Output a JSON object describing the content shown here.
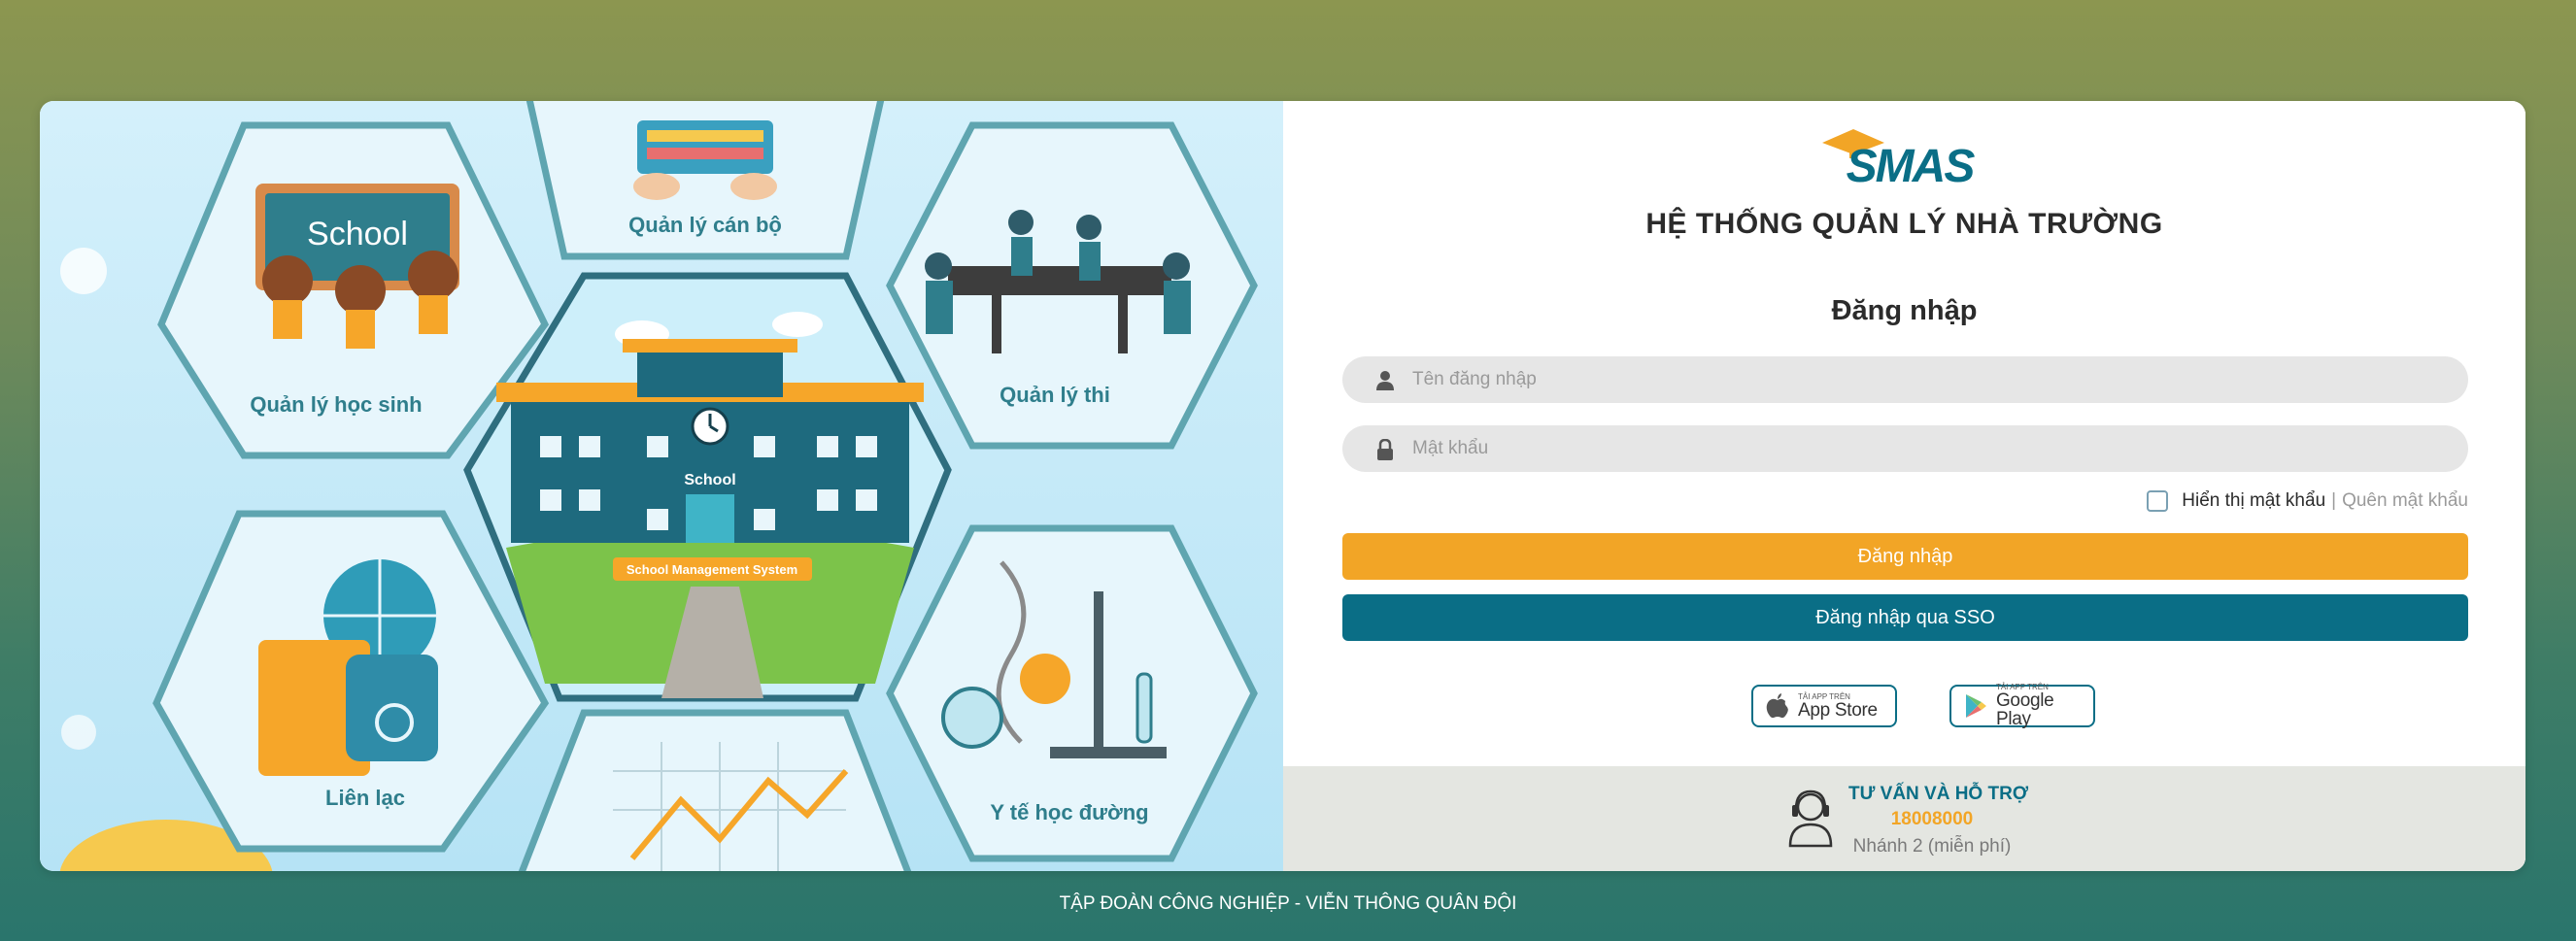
{
  "system_title": "HỆ THỐNG QUẢN LÝ NHÀ TRƯỜNG",
  "logo_text": "SMAS",
  "login_heading": "Đăng nhập",
  "username": {
    "placeholder": "Tên đăng nhập",
    "icon": "user-icon"
  },
  "password": {
    "placeholder": "Mật khẩu",
    "icon": "lock-icon"
  },
  "show_password_label": "Hiển thị mật khẩu",
  "separator": "|",
  "forgot_password": "Quên mật khẩu",
  "login_button": "Đăng nhập",
  "sso_button": "Đăng nhập qua SSO",
  "app_store": {
    "small": "TẢI APP TRÊN",
    "big": "App Store",
    "icon": "apple-icon"
  },
  "google_play": {
    "small": "TẢI APP TRÊN",
    "big": "Google Play",
    "icon": "google-play-icon"
  },
  "support": {
    "title": "TƯ VẤN VÀ HỖ TRỢ",
    "phone": "18008000",
    "note": "Nhánh 2 (miễn phí)",
    "icon": "support-agent-icon"
  },
  "illustration": {
    "hex_labels": [
      "Quản lý cán bộ",
      "Quản lý học sinh",
      "Quản lý thi",
      "Liên lạc",
      "Y tế học đường"
    ],
    "board_text": "School",
    "building_sign": "School",
    "building_banner": "School Management System"
  },
  "footer": "TẬP ĐOÀN CÔNG NGHIỆP - VIỄN THÔNG QUÂN ĐỘI",
  "colors": {
    "accent_orange": "#f2a526",
    "accent_teal": "#0a6e86",
    "bg_top": "#8c9650",
    "bg_bottom": "#2a756c"
  }
}
